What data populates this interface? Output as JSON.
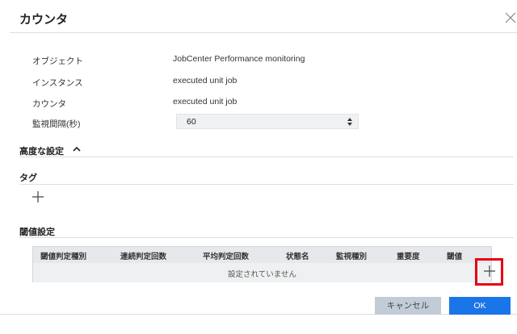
{
  "dialog": {
    "title": "カウンタ"
  },
  "properties": {
    "object_label": "オブジェクト",
    "object_value": "JobCenter Performance monitoring",
    "instance_label": "インスタンス",
    "instance_value": "executed unit job",
    "counter_label": "カウンタ",
    "counter_value": "executed unit job",
    "interval_label": "監視間隔(秒)",
    "interval_value": "60"
  },
  "advanced": {
    "title": "高度な設定"
  },
  "tags": {
    "title": "タグ"
  },
  "threshold": {
    "title": "閾値設定",
    "columns": [
      "閾値判定種別",
      "連続判定回数",
      "平均判定回数",
      "状態名",
      "監視種別",
      "重要度",
      "閾値"
    ],
    "empty_text": "設定されていません"
  },
  "footer": {
    "cancel_label": "キャンセル",
    "ok_label": "OK"
  },
  "colors": {
    "accent": "#1a75e8",
    "highlight": "#e60012",
    "cancel_bg": "#c3cbd6"
  },
  "icons": [
    "close-icon",
    "spinner-icon",
    "chevron-up-icon",
    "plus-icon"
  ]
}
